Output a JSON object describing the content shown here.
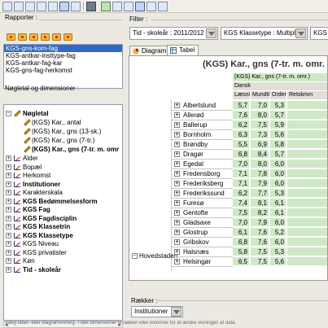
{
  "toolbar": {
    "icons": [
      "new-icon",
      "open-icon",
      "save-icon",
      "copy-icon",
      "paste-icon",
      "table-icon",
      "grid-icon",
      "color-icon",
      "excel-icon",
      "chart-icon",
      "export-icon",
      "sum-icon",
      "sort-icon",
      "window-icon"
    ]
  },
  "left": {
    "rapporter_label": "Rapporter :",
    "rapporter": [
      "KGS-gns-kom-fag",
      "KGS-antkar-insttype-fag",
      "KGS-antkar-fag-kar",
      "KGS-gns-fag-herkomst"
    ],
    "tree_label": "Nøgletal og dimensioner :",
    "tree": {
      "root": "Nøgletal",
      "measures": [
        "(KGS) Kar., antal",
        "(KGS) Kar., gns (13-sk.)",
        "(KGS) Kar., gns (7-tr.)",
        "(KGS) Kar., gns (7-tr. m. omr"
      ],
      "dimensions": [
        {
          "label": "Alder",
          "bold": false
        },
        {
          "label": "Bopæl",
          "bold": false
        },
        {
          "label": "Herkomst",
          "bold": false
        },
        {
          "label": "Institutioner",
          "bold": true
        },
        {
          "label": "Karakterskala",
          "bold": false
        },
        {
          "label": "KGS Bedømmelsesform",
          "bold": true
        },
        {
          "label": "KGS Fag",
          "bold": true
        },
        {
          "label": "KGS Fagdisciplin",
          "bold": true
        },
        {
          "label": "KGS Klassetrin",
          "bold": true
        },
        {
          "label": "KGS Klassetype",
          "bold": true
        },
        {
          "label": "KGS Niveau",
          "bold": false
        },
        {
          "label": "KGS privatister",
          "bold": false
        },
        {
          "label": "Køn",
          "bold": false
        },
        {
          "label": "Tid - skoleår",
          "bold": true
        }
      ]
    }
  },
  "right": {
    "filter_label": "Filter :",
    "filters": [
      "Tid - skoleår : 2011/2012",
      "KGS Klassetype : Multiple",
      "KGS K"
    ],
    "tabs": [
      "Diagram",
      "Tabel"
    ],
    "active_tab": "Tabel",
    "table_title": "(KGS) Kar., gns (7-tr. m. omr.",
    "measure_header": "(KGS) Kar., gns (7-tr. m. omr.)",
    "language_header": "Dansk",
    "columns": [
      "Læsning",
      "Mundtlig",
      "Orden",
      "Retskrivn"
    ],
    "region": "Hovedstaden",
    "rows": [
      {
        "name": "Albertslund",
        "values": [
          "5,7",
          "7,0",
          "5,3"
        ]
      },
      {
        "name": "Allerød",
        "values": [
          "7,6",
          "8,0",
          "5,7"
        ]
      },
      {
        "name": "Ballerup",
        "values": [
          "6,2",
          "7,5",
          "5,9"
        ]
      },
      {
        "name": "Bornholm",
        "values": [
          "6,3",
          "7,3",
          "5,6"
        ]
      },
      {
        "name": "Brøndby",
        "values": [
          "5,5",
          "6,9",
          "5,8"
        ]
      },
      {
        "name": "Dragør",
        "values": [
          "6,8",
          "8,4",
          "5,7"
        ]
      },
      {
        "name": "Egedal",
        "values": [
          "7,0",
          "8,0",
          "6,0"
        ]
      },
      {
        "name": "Fredensborg",
        "values": [
          "7,1",
          "7,8",
          "6,0"
        ]
      },
      {
        "name": "Frederiksberg",
        "values": [
          "7,1",
          "7,9",
          "6,0"
        ]
      },
      {
        "name": "Frederikssund",
        "values": [
          "6,2",
          "7,7",
          "5,3"
        ]
      },
      {
        "name": "Furesø",
        "values": [
          "7,4",
          "8,1",
          "6,1"
        ]
      },
      {
        "name": "Gentofte",
        "values": [
          "7,5",
          "8,2",
          "6,1"
        ]
      },
      {
        "name": "Gladsaxe",
        "values": [
          "7,0",
          "7,9",
          "6,0"
        ]
      },
      {
        "name": "Glostrup",
        "values": [
          "6,1",
          "7,6",
          "5,2"
        ]
      },
      {
        "name": "Gribskov",
        "values": [
          "6,8",
          "7,6",
          "6,0"
        ]
      },
      {
        "name": "Halsnæs",
        "values": [
          "5,8",
          "7,5",
          "5,3"
        ]
      },
      {
        "name": "Helsingør",
        "values": [
          "6,5",
          "7,5",
          "5,6"
        ]
      }
    ],
    "rows_label": "Rækker :",
    "rows_value": "Institutioner"
  },
  "status": "Vælg tabel- eller diagramvisning. Træk dimensioner til rækker eller kolonner for at ændre visningen af data."
}
